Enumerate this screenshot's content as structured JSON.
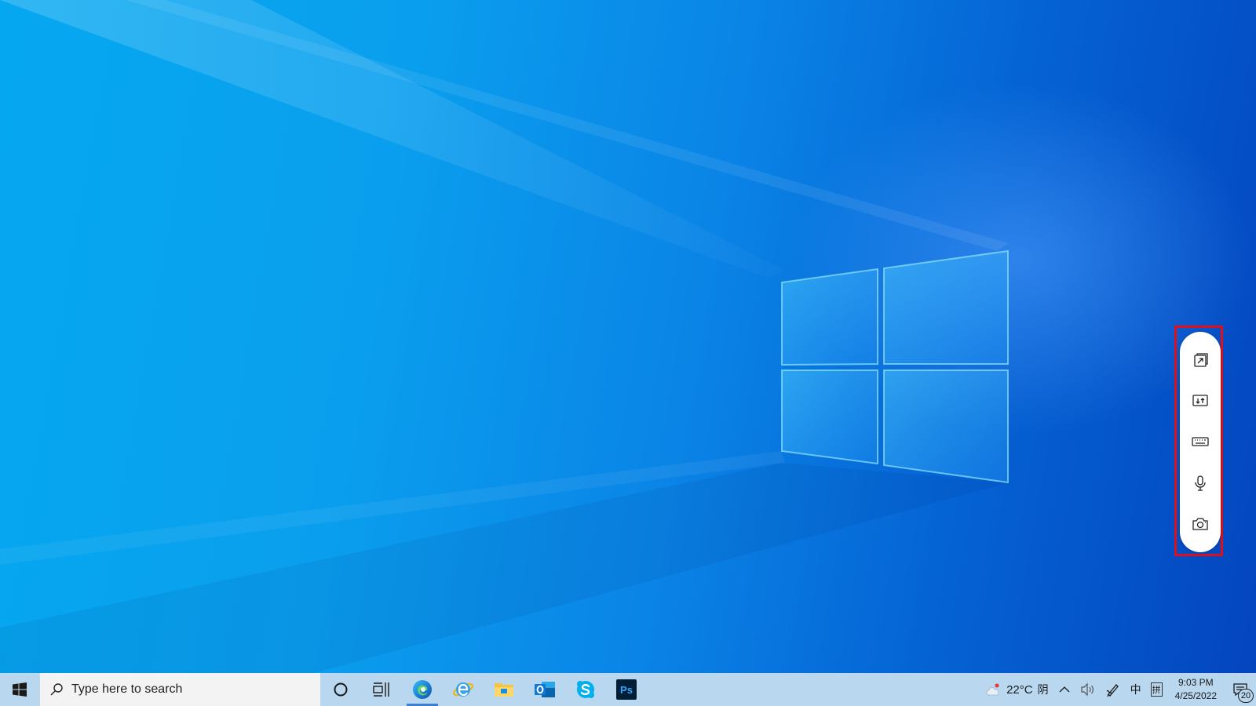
{
  "desktop": {
    "wallpaper": "windows-10-hero",
    "accent_colors": {
      "light": "#05a8f0",
      "dark": "#0445bf",
      "highlight_border": "#e0101a"
    }
  },
  "floating_toolbar": {
    "buttons": [
      {
        "icon": "open-window-icon"
      },
      {
        "icon": "screen-share-icon"
      },
      {
        "icon": "keyboard-icon"
      },
      {
        "icon": "microphone-icon"
      },
      {
        "icon": "camera-icon"
      }
    ]
  },
  "taskbar": {
    "search": {
      "placeholder": "Type here to search"
    },
    "apps": [
      {
        "icon": "cortana-icon"
      },
      {
        "icon": "task-view-icon"
      },
      {
        "icon": "edge-icon",
        "active": true
      },
      {
        "icon": "internet-explorer-icon"
      },
      {
        "icon": "file-explorer-icon"
      },
      {
        "icon": "outlook-icon"
      },
      {
        "icon": "skype-icon"
      },
      {
        "icon": "photoshop-icon",
        "label": "Ps"
      }
    ],
    "tray": {
      "weather_temp": "22°C",
      "weather_condition": "阴",
      "ime_mode": "中",
      "ime_layout": "拼",
      "time": "9:03 PM",
      "date": "4/25/2022",
      "notification_count": "20"
    }
  }
}
